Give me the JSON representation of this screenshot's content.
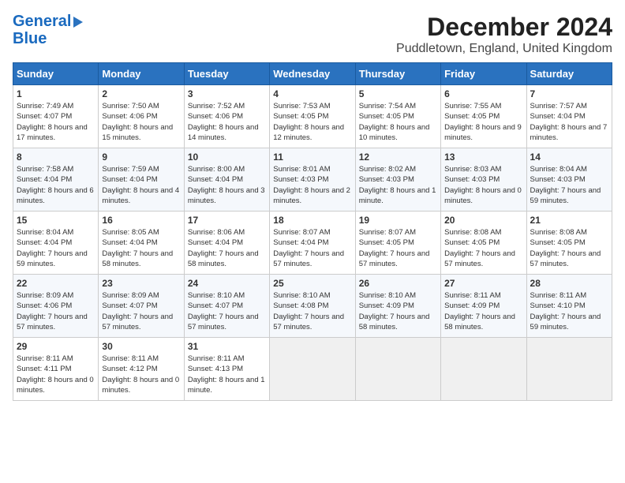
{
  "logo": {
    "line1": "General",
    "line2": "Blue"
  },
  "title": "December 2024",
  "subtitle": "Puddletown, England, United Kingdom",
  "days_of_week": [
    "Sunday",
    "Monday",
    "Tuesday",
    "Wednesday",
    "Thursday",
    "Friday",
    "Saturday"
  ],
  "weeks": [
    [
      {
        "day": "1",
        "content": "Sunrise: 7:49 AM\nSunset: 4:07 PM\nDaylight: 8 hours and 17 minutes."
      },
      {
        "day": "2",
        "content": "Sunrise: 7:50 AM\nSunset: 4:06 PM\nDaylight: 8 hours and 15 minutes."
      },
      {
        "day": "3",
        "content": "Sunrise: 7:52 AM\nSunset: 4:06 PM\nDaylight: 8 hours and 14 minutes."
      },
      {
        "day": "4",
        "content": "Sunrise: 7:53 AM\nSunset: 4:05 PM\nDaylight: 8 hours and 12 minutes."
      },
      {
        "day": "5",
        "content": "Sunrise: 7:54 AM\nSunset: 4:05 PM\nDaylight: 8 hours and 10 minutes."
      },
      {
        "day": "6",
        "content": "Sunrise: 7:55 AM\nSunset: 4:05 PM\nDaylight: 8 hours and 9 minutes."
      },
      {
        "day": "7",
        "content": "Sunrise: 7:57 AM\nSunset: 4:04 PM\nDaylight: 8 hours and 7 minutes."
      }
    ],
    [
      {
        "day": "8",
        "content": "Sunrise: 7:58 AM\nSunset: 4:04 PM\nDaylight: 8 hours and 6 minutes."
      },
      {
        "day": "9",
        "content": "Sunrise: 7:59 AM\nSunset: 4:04 PM\nDaylight: 8 hours and 4 minutes."
      },
      {
        "day": "10",
        "content": "Sunrise: 8:00 AM\nSunset: 4:04 PM\nDaylight: 8 hours and 3 minutes."
      },
      {
        "day": "11",
        "content": "Sunrise: 8:01 AM\nSunset: 4:03 PM\nDaylight: 8 hours and 2 minutes."
      },
      {
        "day": "12",
        "content": "Sunrise: 8:02 AM\nSunset: 4:03 PM\nDaylight: 8 hours and 1 minute."
      },
      {
        "day": "13",
        "content": "Sunrise: 8:03 AM\nSunset: 4:03 PM\nDaylight: 8 hours and 0 minutes."
      },
      {
        "day": "14",
        "content": "Sunrise: 8:04 AM\nSunset: 4:03 PM\nDaylight: 7 hours and 59 minutes."
      }
    ],
    [
      {
        "day": "15",
        "content": "Sunrise: 8:04 AM\nSunset: 4:04 PM\nDaylight: 7 hours and 59 minutes."
      },
      {
        "day": "16",
        "content": "Sunrise: 8:05 AM\nSunset: 4:04 PM\nDaylight: 7 hours and 58 minutes."
      },
      {
        "day": "17",
        "content": "Sunrise: 8:06 AM\nSunset: 4:04 PM\nDaylight: 7 hours and 58 minutes."
      },
      {
        "day": "18",
        "content": "Sunrise: 8:07 AM\nSunset: 4:04 PM\nDaylight: 7 hours and 57 minutes."
      },
      {
        "day": "19",
        "content": "Sunrise: 8:07 AM\nSunset: 4:05 PM\nDaylight: 7 hours and 57 minutes."
      },
      {
        "day": "20",
        "content": "Sunrise: 8:08 AM\nSunset: 4:05 PM\nDaylight: 7 hours and 57 minutes."
      },
      {
        "day": "21",
        "content": "Sunrise: 8:08 AM\nSunset: 4:05 PM\nDaylight: 7 hours and 57 minutes."
      }
    ],
    [
      {
        "day": "22",
        "content": "Sunrise: 8:09 AM\nSunset: 4:06 PM\nDaylight: 7 hours and 57 minutes."
      },
      {
        "day": "23",
        "content": "Sunrise: 8:09 AM\nSunset: 4:07 PM\nDaylight: 7 hours and 57 minutes."
      },
      {
        "day": "24",
        "content": "Sunrise: 8:10 AM\nSunset: 4:07 PM\nDaylight: 7 hours and 57 minutes."
      },
      {
        "day": "25",
        "content": "Sunrise: 8:10 AM\nSunset: 4:08 PM\nDaylight: 7 hours and 57 minutes."
      },
      {
        "day": "26",
        "content": "Sunrise: 8:10 AM\nSunset: 4:09 PM\nDaylight: 7 hours and 58 minutes."
      },
      {
        "day": "27",
        "content": "Sunrise: 8:11 AM\nSunset: 4:09 PM\nDaylight: 7 hours and 58 minutes."
      },
      {
        "day": "28",
        "content": "Sunrise: 8:11 AM\nSunset: 4:10 PM\nDaylight: 7 hours and 59 minutes."
      }
    ],
    [
      {
        "day": "29",
        "content": "Sunrise: 8:11 AM\nSunset: 4:11 PM\nDaylight: 8 hours and 0 minutes."
      },
      {
        "day": "30",
        "content": "Sunrise: 8:11 AM\nSunset: 4:12 PM\nDaylight: 8 hours and 0 minutes."
      },
      {
        "day": "31",
        "content": "Sunrise: 8:11 AM\nSunset: 4:13 PM\nDaylight: 8 hours and 1 minute."
      },
      {
        "day": "",
        "content": ""
      },
      {
        "day": "",
        "content": ""
      },
      {
        "day": "",
        "content": ""
      },
      {
        "day": "",
        "content": ""
      }
    ]
  ]
}
